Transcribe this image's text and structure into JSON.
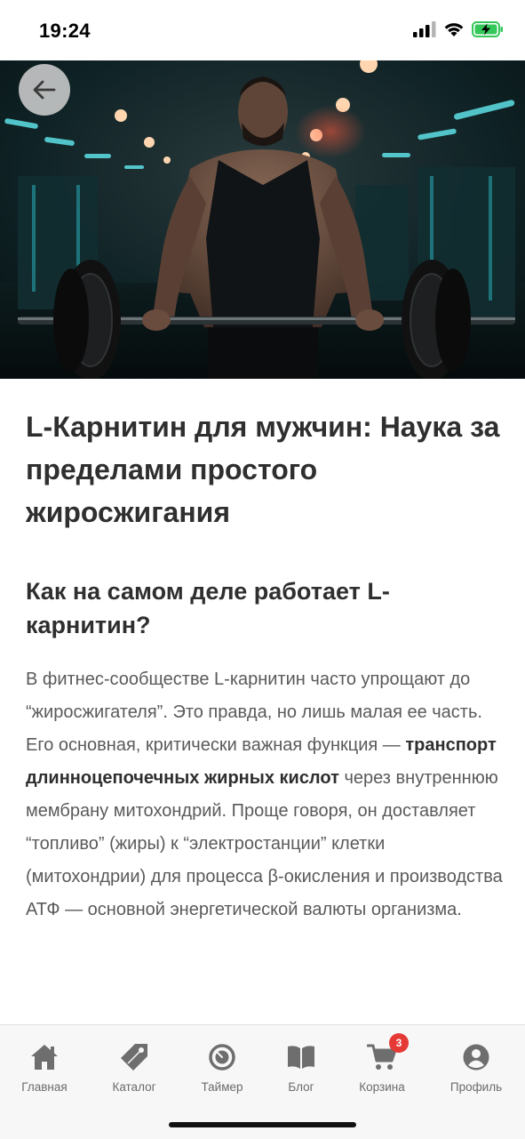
{
  "status_bar": {
    "time": "19:24"
  },
  "hero": {
    "image": "gym-man-lifting-barbell-photo"
  },
  "article": {
    "title": "L-Карнитин для мужчин: Наука за пределами простого жиросжигания",
    "subtitle": "Как на самом деле работает L-карнитин?",
    "body_part1": "В фитнес-сообществе L-карнитин часто упрощают до “жиросжигателя”. Это правда, но лишь малая ее часть. Его основная, критически важная функция — ",
    "body_bold": "транспорт длинноцепочечных жирных кислот",
    "body_part2": " через внутреннюю мембрану митохондрий. Проще говоря, он доставляет “топливо” (жиры) к “электростанции” клетки (митохондрии) для процесса β-окисления и производства АТФ — основной энергетической валюты организма."
  },
  "bottom_nav": {
    "items": [
      {
        "label": "Главная",
        "icon": "home-icon"
      },
      {
        "label": "Каталог",
        "icon": "tag-icon"
      },
      {
        "label": "Таймер",
        "icon": "timer-icon"
      },
      {
        "label": "Блог",
        "icon": "book-icon"
      },
      {
        "label": "Корзина",
        "icon": "cart-icon",
        "badge": "3"
      },
      {
        "label": "Профиль",
        "icon": "profile-icon"
      }
    ]
  },
  "colors": {
    "badge": "#e53935",
    "nav_icon": "#6e6e6e",
    "battery": "#34c759"
  }
}
